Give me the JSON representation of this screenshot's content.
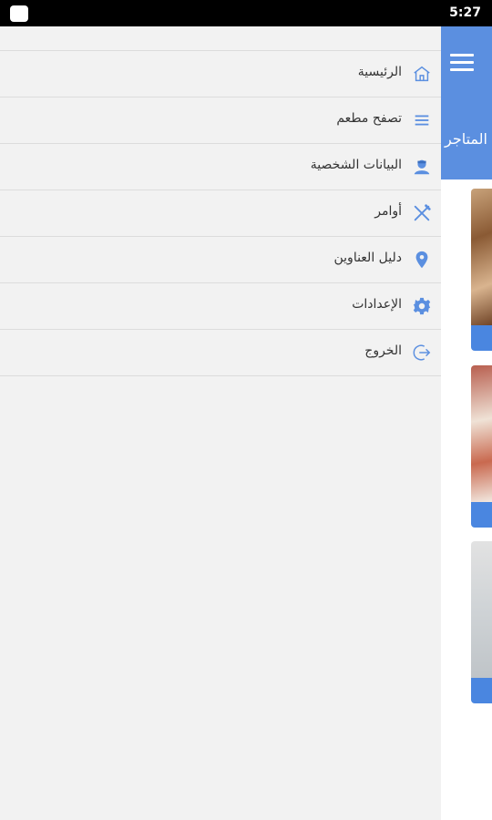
{
  "status_bar": {
    "time": "5:27"
  },
  "app": {
    "title": "المتاجر"
  },
  "drawer": {
    "items": [
      {
        "label": "الرئيسية",
        "icon": "home-icon"
      },
      {
        "label": "تصفح مطعم",
        "icon": "list-icon"
      },
      {
        "label": "البيانات الشخصية",
        "icon": "person-icon"
      },
      {
        "label": "أوامر",
        "icon": "utensils-icon"
      },
      {
        "label": "دليل العناوين",
        "icon": "location-pin-icon"
      },
      {
        "label": "الإعدادات",
        "icon": "gear-icon"
      },
      {
        "label": "الخروج",
        "icon": "logout-icon"
      }
    ]
  },
  "colors": {
    "accent": "#5b8fe0",
    "card_bar": "#4a86e0",
    "icon": "#5b8fe0",
    "drawer_bg": "#f2f2f2"
  }
}
